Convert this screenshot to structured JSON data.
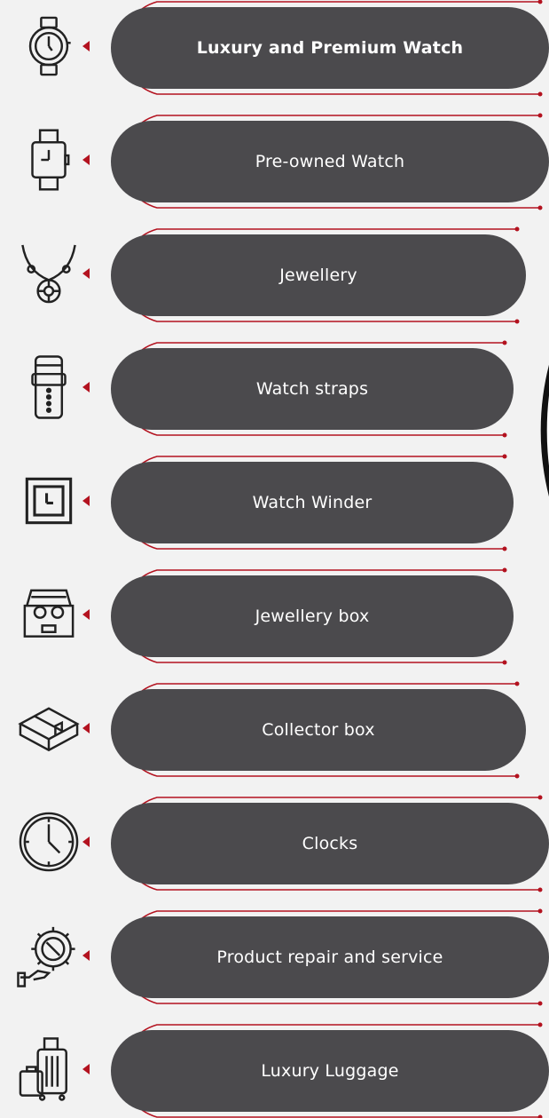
{
  "categories": [
    {
      "label": "Luxury and Premium Watch",
      "icon": "wristwatch-icon",
      "active": true
    },
    {
      "label": "Pre-owned Watch",
      "icon": "square-watch-icon",
      "active": false
    },
    {
      "label": "Jewellery",
      "icon": "necklace-icon",
      "active": false
    },
    {
      "label": "Watch straps",
      "icon": "watch-strap-icon",
      "active": false
    },
    {
      "label": "Watch Winder",
      "icon": "watch-winder-icon",
      "active": false
    },
    {
      "label": "Jewellery box",
      "icon": "jewellery-box-icon",
      "active": false
    },
    {
      "label": "Collector box",
      "icon": "collector-box-icon",
      "active": false
    },
    {
      "label": "Clocks",
      "icon": "clock-icon",
      "active": false
    },
    {
      "label": "Product repair and service",
      "icon": "repair-service-icon",
      "active": false
    },
    {
      "label": "Luxury Luggage",
      "icon": "luggage-icon",
      "active": false
    }
  ],
  "colors": {
    "background": "#f2f2f2",
    "pill": "#4b4a4d",
    "accent": "#b3121f",
    "text": "#ffffff",
    "icon_stroke": "#222222"
  }
}
